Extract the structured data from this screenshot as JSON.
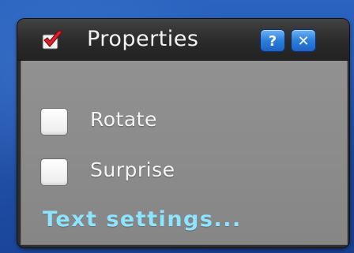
{
  "window": {
    "title": "Properties",
    "title_icon": "checkmark-icon",
    "help_button": {
      "label": "?",
      "icon": "help-icon"
    },
    "close_button": {
      "label": "✕",
      "icon": "close-icon"
    }
  },
  "options": [
    {
      "label": "Rotate",
      "checked": false
    },
    {
      "label": "Surprise",
      "checked": false
    }
  ],
  "link": {
    "text_settings": "Text settings..."
  },
  "colors": {
    "title_bar": "#2d2d2d",
    "content_bg": "#8c8c8c",
    "button_blue": "#2b7fdc",
    "link_cyan": "#8ee3ff",
    "check_red": "#e0202a",
    "desktop_blue": "#1d4fa6"
  }
}
